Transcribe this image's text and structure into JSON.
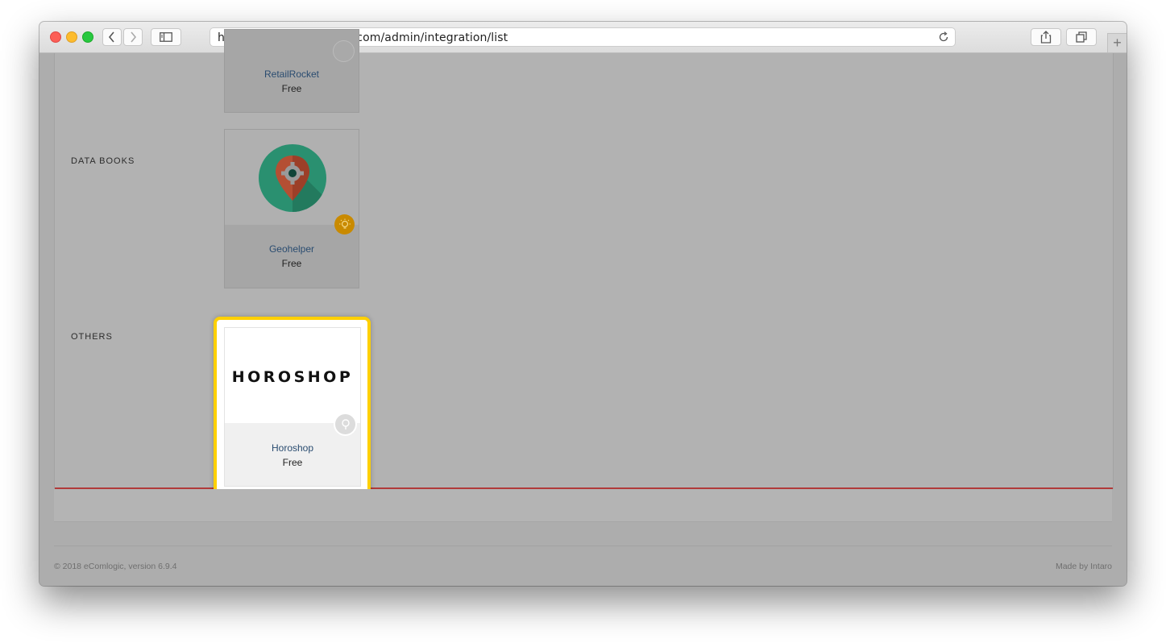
{
  "browser": {
    "url": "https://demo.ecomlogic.com/admin/integration/list"
  },
  "sections": [
    {
      "label": "DATA BOOKS"
    },
    {
      "label": "OTHERS"
    }
  ],
  "cards": {
    "retailrocket": {
      "name": "RetailRocket",
      "price": "Free"
    },
    "geohelper": {
      "name": "Geohelper",
      "price": "Free",
      "badge_icon": "lightbulb-icon",
      "badge_color": "#c98a00"
    },
    "horoshop": {
      "name": "Horoshop",
      "price": "Free",
      "logo_text": "HOROSHOP",
      "badge_icon": "lightbulb-icon",
      "highlight_color": "#ffd000"
    }
  },
  "footer": {
    "copyright": "© 2018 eComlogic, version 6.9.4",
    "made_by": "Made by Intaro"
  },
  "colors": {
    "accent_line": "#b13a3a",
    "link": "#2a4c70"
  }
}
